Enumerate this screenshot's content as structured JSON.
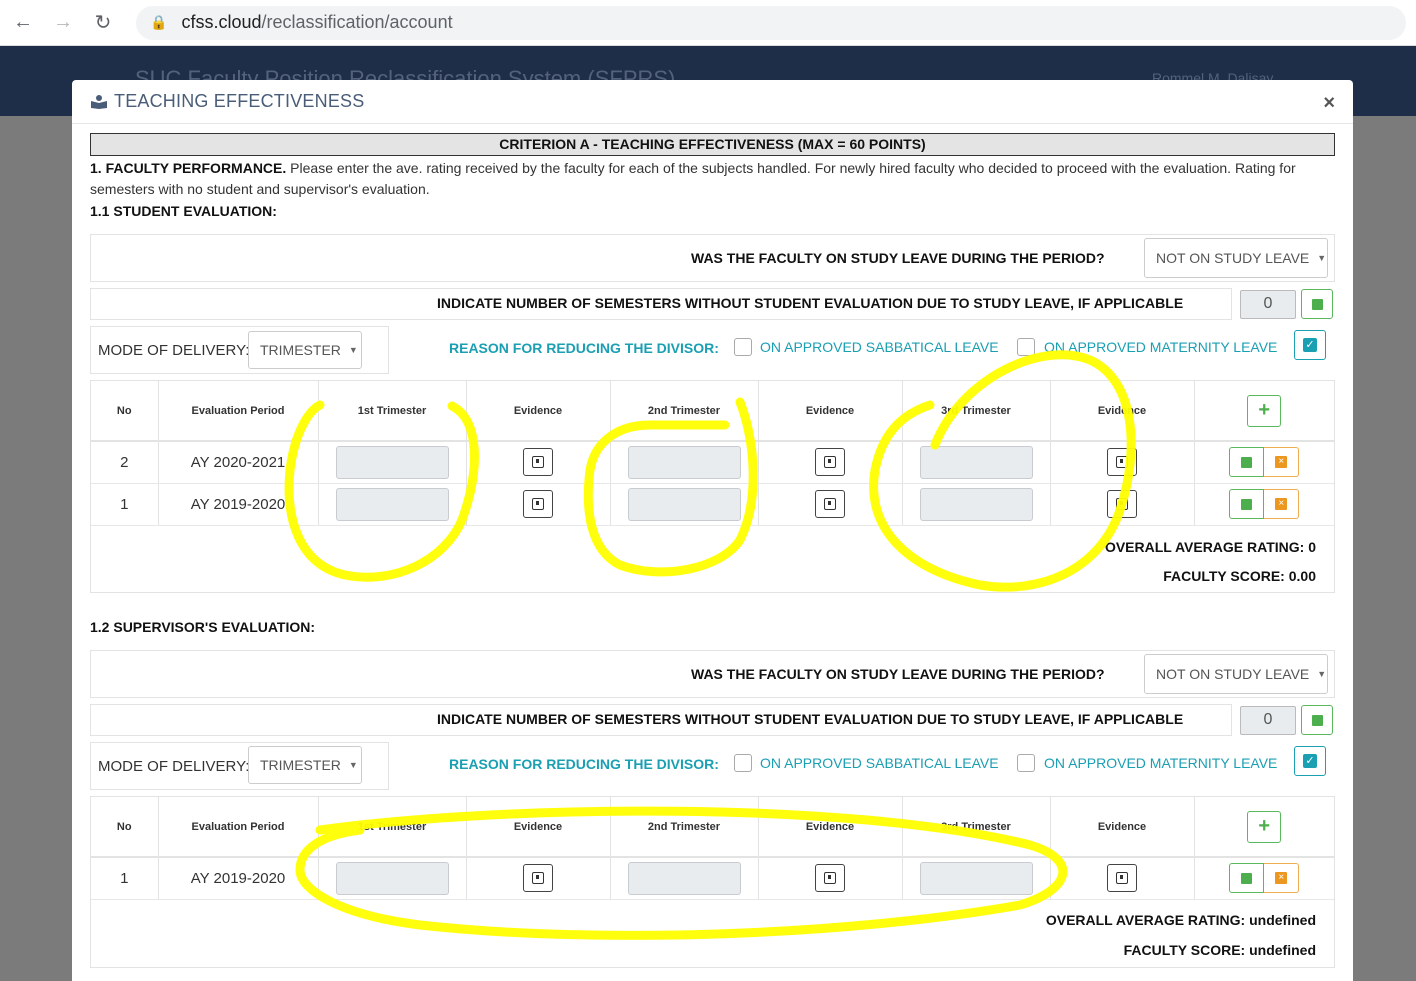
{
  "browser": {
    "domain": "cfss.cloud",
    "path": "/reclassification/account"
  },
  "app": {
    "title": "SUC Faculty Position Reclassification System (SFPRS)",
    "user": "Rommel M. Dalisay"
  },
  "modal": {
    "title": "TEACHING EFFECTIVENESS",
    "close": "×"
  },
  "criterion": "CRITERION A - TEACHING EFFECTIVENESS (MAX = 60 POINTS)",
  "faculty_performance": {
    "heading": "1. FACULTY PERFORMANCE.",
    "text": " Please enter the ave. rating received by the faculty for each of the subjects handled. For newly hired faculty who decided to proceed with the evaluation. Rating for semesters with no student and supervisor's evaluation."
  },
  "sections": [
    {
      "title": "1.1 STUDENT EVALUATION:",
      "study_leave_question": "WAS THE FACULTY ON STUDY LEAVE DURING THE PERIOD?",
      "study_leave_value": "NOT ON STUDY LEAVE",
      "semesters_question": "INDICATE NUMBER OF SEMESTERS WITHOUT STUDENT EVALUATION DUE TO STUDY LEAVE, IF APPLICABLE",
      "semesters_value": "0",
      "mode_label": "MODE OF DELIVERY:",
      "mode_value": "TRIMESTER",
      "reason_label": "REASON FOR REDUCING THE DIVISOR:",
      "sabbatical_label": "ON APPROVED SABBATICAL LEAVE",
      "maternity_label": "ON APPROVED MATERNITY LEAVE",
      "columns": [
        "No",
        "Evaluation Period",
        "1st Trimester",
        "Evidence",
        "2nd Trimester",
        "Evidence",
        "3rd Trimester",
        "Evidence"
      ],
      "rows": [
        {
          "no": "2",
          "period": "AY 2020-2021"
        },
        {
          "no": "1",
          "period": "AY 2019-2020"
        }
      ],
      "overall": "OVERALL AVERAGE RATING: 0",
      "score": "FACULTY SCORE: 0.00"
    },
    {
      "title": "1.2 SUPERVISOR'S EVALUATION:",
      "study_leave_question": "WAS THE FACULTY ON STUDY LEAVE DURING THE PERIOD?",
      "study_leave_value": "NOT ON STUDY LEAVE",
      "semesters_question": "INDICATE NUMBER OF SEMESTERS WITHOUT STUDENT EVALUATION DUE TO STUDY LEAVE, IF APPLICABLE",
      "semesters_value": "0",
      "mode_label": "MODE OF DELIVERY:",
      "mode_value": "TRIMESTER",
      "reason_label": "REASON FOR REDUCING THE DIVISOR:",
      "sabbatical_label": "ON APPROVED SABBATICAL LEAVE",
      "maternity_label": "ON APPROVED MATERNITY LEAVE",
      "columns": [
        "No",
        "Evaluation Period",
        "1st Trimester",
        "Evidence",
        "2nd Trimester",
        "Evidence",
        "3rd Trimester",
        "Evidence"
      ],
      "rows": [
        {
          "no": "1",
          "period": "AY 2019-2020"
        }
      ],
      "overall": "OVERALL AVERAGE RATING: undefined",
      "score": "FACULTY SCORE: undefined"
    }
  ],
  "colors": {
    "accent": "#1a9fb3",
    "success": "#5cb85c",
    "warning": "#f0ad4e",
    "header_bg": "#1f2e48",
    "annotation": "#ffff00"
  }
}
